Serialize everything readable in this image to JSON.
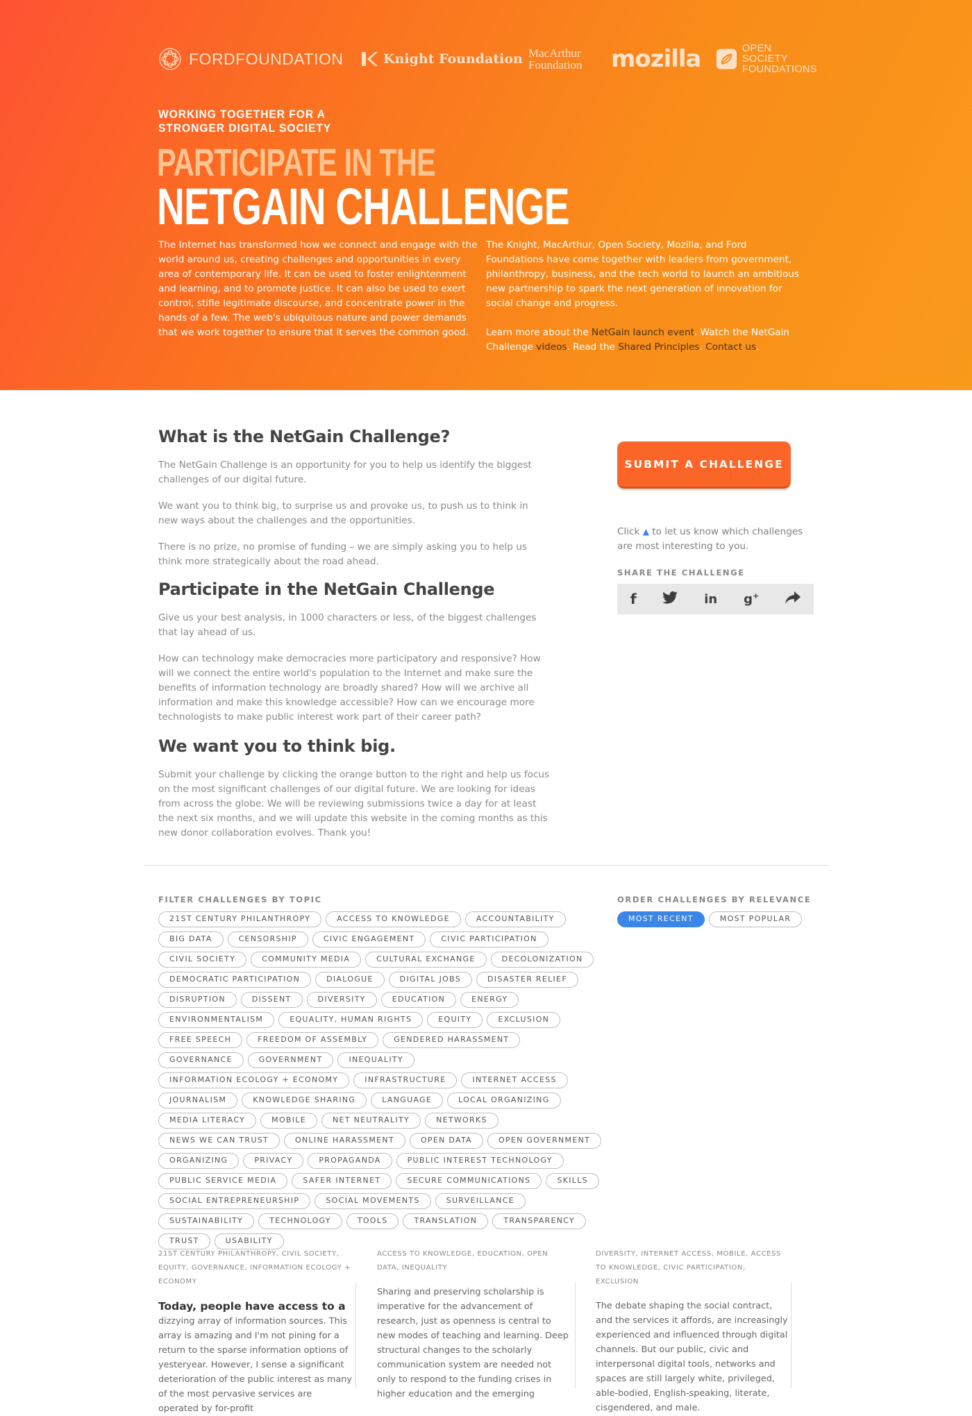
{
  "logos": {
    "ford": "FORDFOUNDATION",
    "knight": "Knight Foundation",
    "macarthur_1": "MacArthur",
    "macarthur_2": "Foundation",
    "mozilla": "mozilla",
    "osf_1": "OPEN SOCIETY",
    "osf_2": "FOUNDATIONS"
  },
  "hero": {
    "kicker": "WORKING TOGETHER FOR A STRONGER DIGITAL SOCIETY",
    "title_light": "PARTICIPATE IN THE",
    "title_main": "NETGAIN CHALLENGE",
    "intro_left": "The Internet has transformed how we connect and engage with the world around us, creating challenges and opportunities in every area of contemporary life. It can be used to foster enlightenment and learning, and to promote justice. It can also be used to exert control, stifle legitimate discourse, and concentrate power in the hands of a few. The web's ubiquitous nature and power demands that we work together to ensure that it serves the common good.",
    "intro_right": "The Knight, MacArthur, Open Society, Mozilla, and Ford Foundations have come together with leaders from government, philanthropy, business, and the tech world to launch an ambitious new partnership to spark the next generation of innovation for social change and progress.",
    "links": {
      "learn_prefix": "Learn more about the ",
      "launch_event": "NetGain launch event",
      "watch_prefix": ". Watch the NetGain Challenge ",
      "videos": "videos",
      "read_prefix": ". Read the ",
      "principles": "Shared Principles",
      "sep": ". ",
      "contact": "Contact us",
      "end": "."
    }
  },
  "main": {
    "h1": "What is the NetGain Challenge?",
    "p1": "The NetGain Challenge is an opportunity for you to help us identify the biggest challenges of our digital future.",
    "p2": "We want you to think big, to surprise us and provoke us, to push us to think in new ways about the challenges and the opportunities.",
    "p3": "There is no prize, no promise of funding – we are simply asking you to help us think more strategically about the road ahead.",
    "h2": "Participate in the NetGain Challenge",
    "p4": "Give us your best analysis, in 1000 characters or less, of the biggest challenges that lay ahead of us.",
    "p5": "How can technology make democracies more participatory and responsive? How will we connect the entire world's population to the Internet and make sure the benefits of information technology are broadly shared? How will we archive all information and make this knowledge accessible? How can we encourage more technologists to make public interest work part of their career path?",
    "h3": "We want you to think big.",
    "p6": "Submit your challenge by clicking the orange button to the right and help us focus on the most significant challenges of our digital future. We are looking for ideas from across the globe. We will be reviewing submissions twice a day for at least the next six months, and we will update this website in the coming months as this new donor collaboration evolves. Thank you!"
  },
  "sidebar": {
    "submit": "SUBMIT A CHALLENGE",
    "click_prefix": "Click",
    "click_suffix": "to let us know which challenges are most interesting to you.",
    "share_label": "SHARE THE CHALLENGE",
    "share_icons": [
      "facebook-icon",
      "twitter-icon",
      "linkedin-icon",
      "google-plus-icon",
      "share-icon"
    ]
  },
  "filters": {
    "topic_label": "FILTER CHALLENGES BY TOPIC",
    "order_label": "ORDER CHALLENGES BY RELEVANCE",
    "topics": [
      "21st Century Philanthropy",
      "Access to Knowledge",
      "Accountability",
      "Big Data",
      "Censorship",
      "Civic Engagement",
      "Civic Participation",
      "Civil Society",
      "Community Media",
      "Cultural Exchange",
      "Decolonization",
      "Democratic Participation",
      "Dialogue",
      "Digital Jobs",
      "Disaster Relief",
      "Disruption",
      "Dissent",
      "Diversity",
      "Education",
      "Energy",
      "Environmentalism",
      "Equality, Human Rights",
      "Equity",
      "Exclusion",
      "Free Speech",
      "Freedom of Assembly",
      "Gendered Harassment",
      "Governance",
      "Government",
      "Inequality",
      "Information Ecology + Economy",
      "Infrastructure",
      "Internet Access",
      "Journalism",
      "Knowledge Sharing",
      "Language",
      "Local Organizing",
      "Media Literacy",
      "Mobile",
      "Net Neutrality",
      "Networks",
      "News We Can Trust",
      "Online Harassment",
      "Open Data",
      "Open Government",
      "Organizing",
      "Privacy",
      "Propaganda",
      "Public Interest Technology",
      "Public Service Media",
      "Safer Internet",
      "Secure Communications",
      "Skills",
      "Social Entrepreneurship",
      "Social Movements",
      "Surveillance",
      "Sustainability",
      "Technology",
      "Tools",
      "Translation",
      "Transparency",
      "Trust",
      "Usability"
    ],
    "order": [
      "MOST RECENT",
      "MOST POPULAR"
    ]
  },
  "cards": [
    {
      "topics": "21ST CENTURY PHILANTHROPY, CIVIL SOCIETY, EQUITY, GOVERNANCE, INFORMATION ECOLOGY + ECONOMY",
      "lead": "Today, people have access to a",
      "body": "dizzying array of information sources. This array is amazing and I'm not pining for a return to the sparse information options of yesteryear. However, I sense a significant deterioration of the public interest as many of the most pervasive services are operated by for-profit"
    },
    {
      "topics": "ACCESS TO KNOWLEDGE, EDUCATION, OPEN DATA, INEQUALITY",
      "lead": "",
      "body": "Sharing and preserving scholarship is imperative for the advancement of research, just as openness is central to new modes of teaching and learning. Deep structural changes to the scholarly communication system are needed not only to respond to the funding crises in higher education and the emerging"
    },
    {
      "topics": "DIVERSITY, INTERNET ACCESS, MOBILE, ACCESS TO KNOWLEDGE, CIVIC PARTICIPATION, EXCLUSION",
      "lead": "",
      "body": "The debate shaping the social contract, and the services it affords, are increasingly experienced and influenced through digital channels. But our public, civic and interpersonal digital tools, networks and spaces are still largely white, privileged, able-bodied, English-speaking, literate, cisgendered, and male."
    }
  ]
}
